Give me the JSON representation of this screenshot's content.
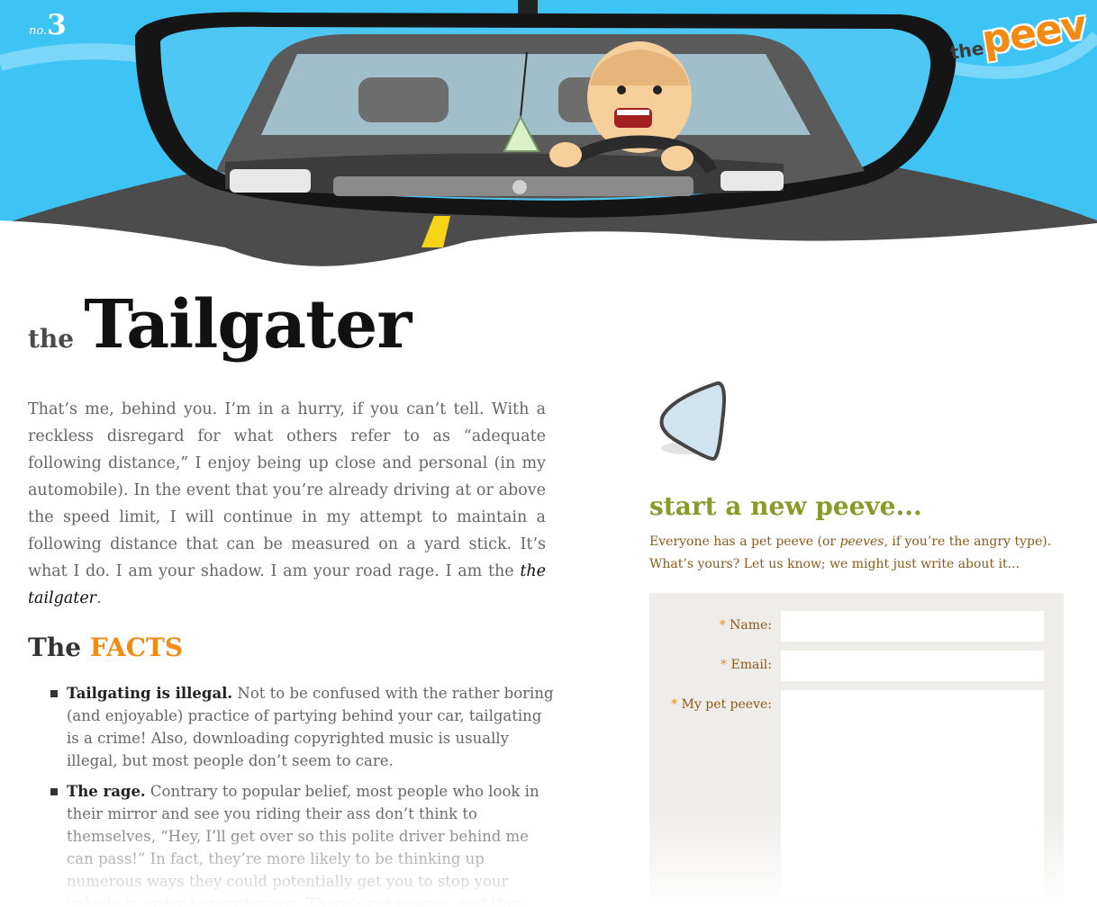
{
  "header": {
    "issue_prefix": "no.",
    "issue_number": "3",
    "logo_the": "the",
    "logo_peev": "peev",
    "sky_color": "#3ec3f5",
    "road_color": "#4c4c4c"
  },
  "title": {
    "prefix": "the",
    "main": "Tailgater"
  },
  "intro": {
    "text": "That’s me, behind you. I’m in a hurry, if you can’t tell. With a reckless disregard for what others refer to as “adequate following distance,” I enjoy being up close and personal (in my automobile). In the event that you’re already driving at or above the speed limit, I will continue in my attempt to maintain a following distance that can be measured on a yard stick. It’s what I do. I am your shadow. I am your road rage. I am the ",
    "em": "the tailgater",
    "end": "."
  },
  "facts": {
    "heading_the": "The",
    "heading_facts": "FACTS",
    "items": [
      {
        "bold": "Tailgating is illegal.",
        "text": " Not to be confused with the rather boring (and enjoyable) practice of partying behind your car, tailgating is a crime! Also, downloading copyrighted music is usually illegal, but most people don’t seem to care."
      },
      {
        "bold": "The rage.",
        "text": " Contrary to popular belief, most people who look in their mirror and see you riding their ass don’t think to themselves, “Hey, I’ll get over so this polite driver behind me can pass!” In fact, they’re more likely to be thinking up numerous ways they could potentially get you to stop your vehicle in order to murder you. There’s pet peeves, and then there’s PET PEEVES. Tailgater..."
      }
    ]
  },
  "sidebar": {
    "heading": "start a new peeve...",
    "text_before": "Everyone has a pet peeve (or ",
    "text_em": "peeves",
    "text_after": ", if you’re the angry type). What’s yours? Let us know; we might just write about it...",
    "form": {
      "required_mark": "*",
      "name_label": "Name:",
      "email_label": "Email:",
      "peeve_label": "My pet peeve:",
      "name_value": "",
      "email_value": "",
      "peeve_value": ""
    }
  }
}
